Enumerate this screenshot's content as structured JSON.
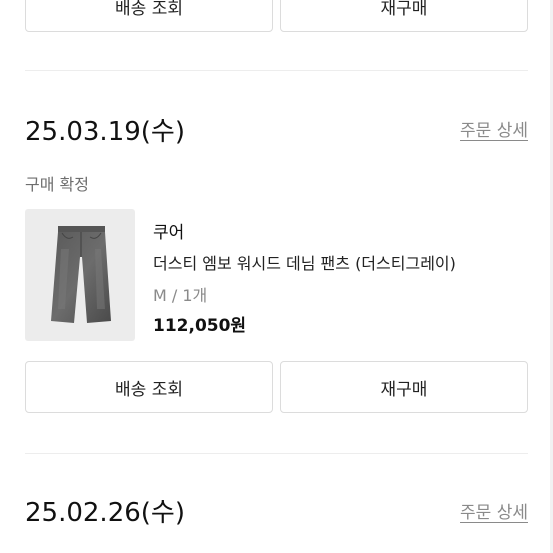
{
  "top_partial": {
    "tracking_label": "배송 조회",
    "rebuy_label": "재구매"
  },
  "order1": {
    "date": "25.03.19(수)",
    "detail_link": "주문 상세",
    "status": "구매 확정",
    "product": {
      "brand": "쿠어",
      "name": "더스티 엠보 워시드 데님 팬츠 (더스티그레이)",
      "option": "M / 1개",
      "price": "112,050원",
      "image_icon": "denim-pants-icon"
    },
    "tracking_label": "배송 조회",
    "rebuy_label": "재구매"
  },
  "order2": {
    "date": "25.02.26(수)",
    "detail_link": "주문 상세"
  },
  "colors": {
    "text_primary": "#111111",
    "text_muted": "#8a8a8a",
    "border": "#dcdcdc",
    "thumb_bg": "#ececec"
  }
}
